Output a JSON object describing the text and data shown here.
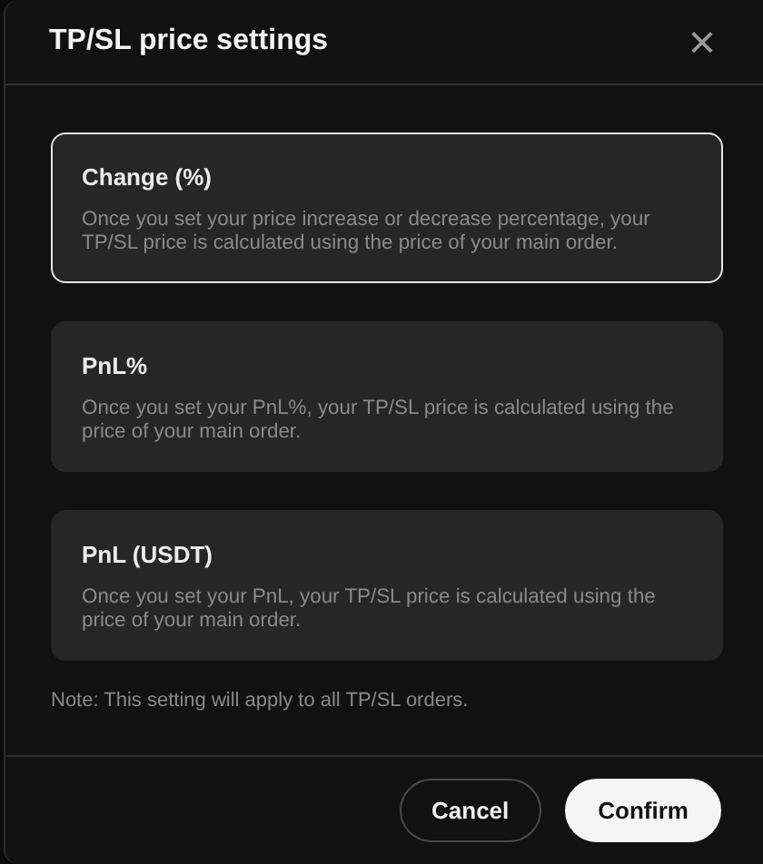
{
  "dialog": {
    "title": "TP/SL price settings",
    "close": "×"
  },
  "options": [
    {
      "title": "Change (%)",
      "description": "Once you set your price increase or decrease percentage, your TP/SL price is calculated using the price of your main order.",
      "selected": true
    },
    {
      "title": "PnL%",
      "description": "Once you set your PnL%, your TP/SL price is calculated using the price of your main order.",
      "selected": false
    },
    {
      "title": "PnL (USDT)",
      "description": "Once you set your PnL, your TP/SL price is calculated using the price of your main order.",
      "selected": false
    }
  ],
  "note": "Note: This setting will apply to all TP/SL orders.",
  "buttons": [
    {
      "label": "Cancel",
      "kind": "secondary"
    },
    {
      "label": "Confirm",
      "kind": "primary"
    }
  ]
}
